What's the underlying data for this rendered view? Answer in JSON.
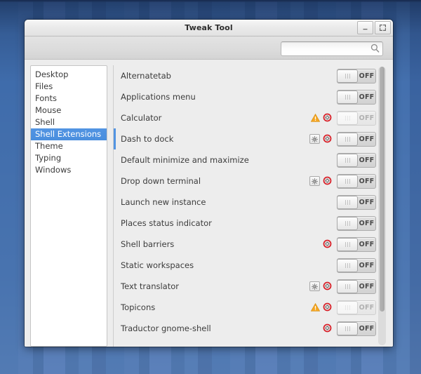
{
  "window": {
    "title": "Tweak Tool",
    "buttons": [
      {
        "name": "minimize-button",
        "glyph": "minimize"
      },
      {
        "name": "maximize-button",
        "glyph": "maximize"
      }
    ]
  },
  "search": {
    "value": "",
    "placeholder": "",
    "icon": "search-icon"
  },
  "sidebar": {
    "items": [
      {
        "label": "Desktop",
        "selected": false
      },
      {
        "label": "Files",
        "selected": false
      },
      {
        "label": "Fonts",
        "selected": false
      },
      {
        "label": "Mouse",
        "selected": false
      },
      {
        "label": "Shell",
        "selected": false
      },
      {
        "label": "Shell Extensions",
        "selected": true
      },
      {
        "label": "Theme",
        "selected": false
      },
      {
        "label": "Typing",
        "selected": false
      },
      {
        "label": "Windows",
        "selected": false
      }
    ]
  },
  "extensions": {
    "rows": [
      {
        "label": "Alternatetab",
        "state": "OFF",
        "enabled": true,
        "icons": []
      },
      {
        "label": "Applications menu",
        "state": "OFF",
        "enabled": true,
        "icons": []
      },
      {
        "label": "Calculator",
        "state": "OFF",
        "enabled": false,
        "icons": [
          "warning-icon",
          "remove-icon"
        ]
      },
      {
        "label": "Dash to dock",
        "state": "OFF",
        "enabled": true,
        "icons": [
          "prefs-icon",
          "remove-icon"
        ],
        "selected": true
      },
      {
        "label": "Default minimize and maximize",
        "state": "OFF",
        "enabled": true,
        "icons": []
      },
      {
        "label": "Drop down terminal",
        "state": "OFF",
        "enabled": true,
        "icons": [
          "prefs-icon",
          "remove-icon"
        ]
      },
      {
        "label": "Launch new instance",
        "state": "OFF",
        "enabled": true,
        "icons": []
      },
      {
        "label": "Places status indicator",
        "state": "OFF",
        "enabled": true,
        "icons": []
      },
      {
        "label": "Shell barriers",
        "state": "OFF",
        "enabled": true,
        "icons": [
          "remove-icon"
        ]
      },
      {
        "label": "Static workspaces",
        "state": "OFF",
        "enabled": true,
        "icons": []
      },
      {
        "label": "Text translator",
        "state": "OFF",
        "enabled": true,
        "icons": [
          "prefs-icon",
          "remove-icon"
        ]
      },
      {
        "label": "Topicons",
        "state": "OFF",
        "enabled": false,
        "icons": [
          "warning-icon",
          "remove-icon"
        ]
      },
      {
        "label": "Traductor gnome-shell",
        "state": "OFF",
        "enabled": true,
        "icons": [
          "remove-icon"
        ]
      }
    ]
  },
  "scrollbar": {
    "thumb_fraction": 0.88
  },
  "colors": {
    "selection": "#5294e2",
    "warning": "#f5a623",
    "error": "#d8222a",
    "window_bg": "#ededed",
    "desktop_blue": "#3f6cab"
  }
}
